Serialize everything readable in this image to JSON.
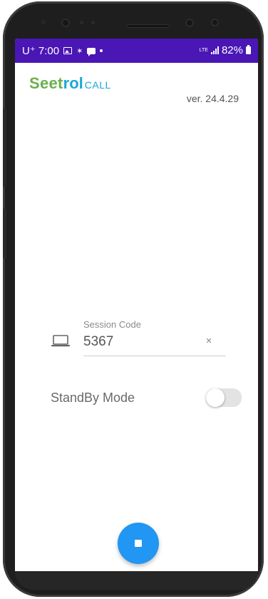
{
  "status_bar": {
    "carrier_time": "U⁺ 7:00",
    "lte": "LTE",
    "battery": "82%",
    "left_icons": [
      "gallery-icon",
      "spark-icon",
      "chat-icon",
      "dot-icon"
    ],
    "right_icons": [
      "lte-icon",
      "signal-icon",
      "battery-icon"
    ],
    "color": "#4a16b5"
  },
  "header": {
    "logo_main": "Seet",
    "logo_accent": "rol",
    "logo_sub": "CALL",
    "version": "ver. 24.4.29"
  },
  "session": {
    "label": "Session Code",
    "value": "5367",
    "clear_symbol": "×",
    "icon": "laptop-icon"
  },
  "standby": {
    "label": "StandBy Mode",
    "enabled": false
  },
  "fab": {
    "icon": "stop-icon",
    "color": "#2196f3"
  }
}
